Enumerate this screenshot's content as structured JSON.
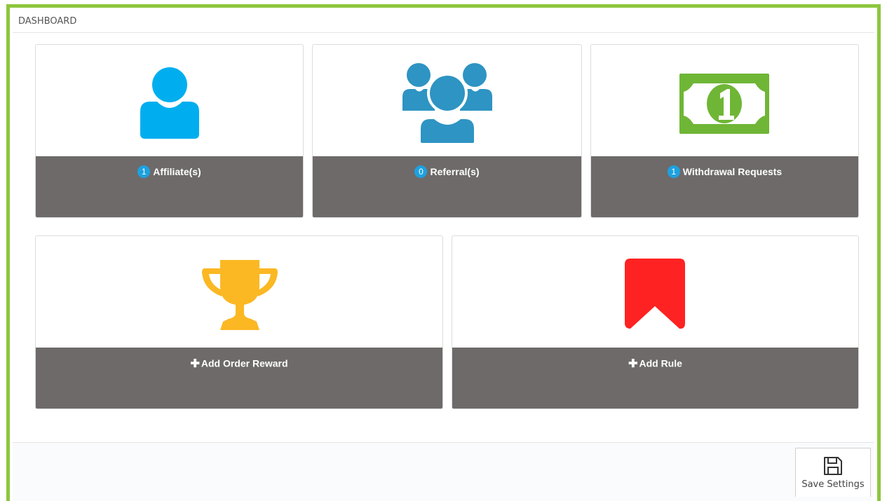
{
  "panel": {
    "title": "DASHBOARD"
  },
  "cards": {
    "affiliates": {
      "count": "1",
      "label": "Affiliate(s)",
      "icon": "user-icon"
    },
    "referrals": {
      "count": "0",
      "label": "Referral(s)",
      "icon": "users-icon"
    },
    "withdrawals": {
      "count": "1",
      "label": "Withdrawal Requests",
      "icon": "money-icon"
    },
    "order_reward": {
      "plus": "✚",
      "label": "Add Order Reward",
      "icon": "trophy-icon"
    },
    "rule": {
      "plus": "✚",
      "label": "Add Rule",
      "icon": "bookmark-icon"
    }
  },
  "footer": {
    "save_label": "Save Settings",
    "save_icon": "floppy-disk-icon"
  },
  "colors": {
    "frame": "#8dc63f",
    "card_bar": "#6e6a6a",
    "badge": "#1da1e0",
    "user": "#00aeef",
    "users": "#2e94c3",
    "money": "#6fb636",
    "trophy": "#fbb823",
    "bookmark": "#ff2222"
  }
}
